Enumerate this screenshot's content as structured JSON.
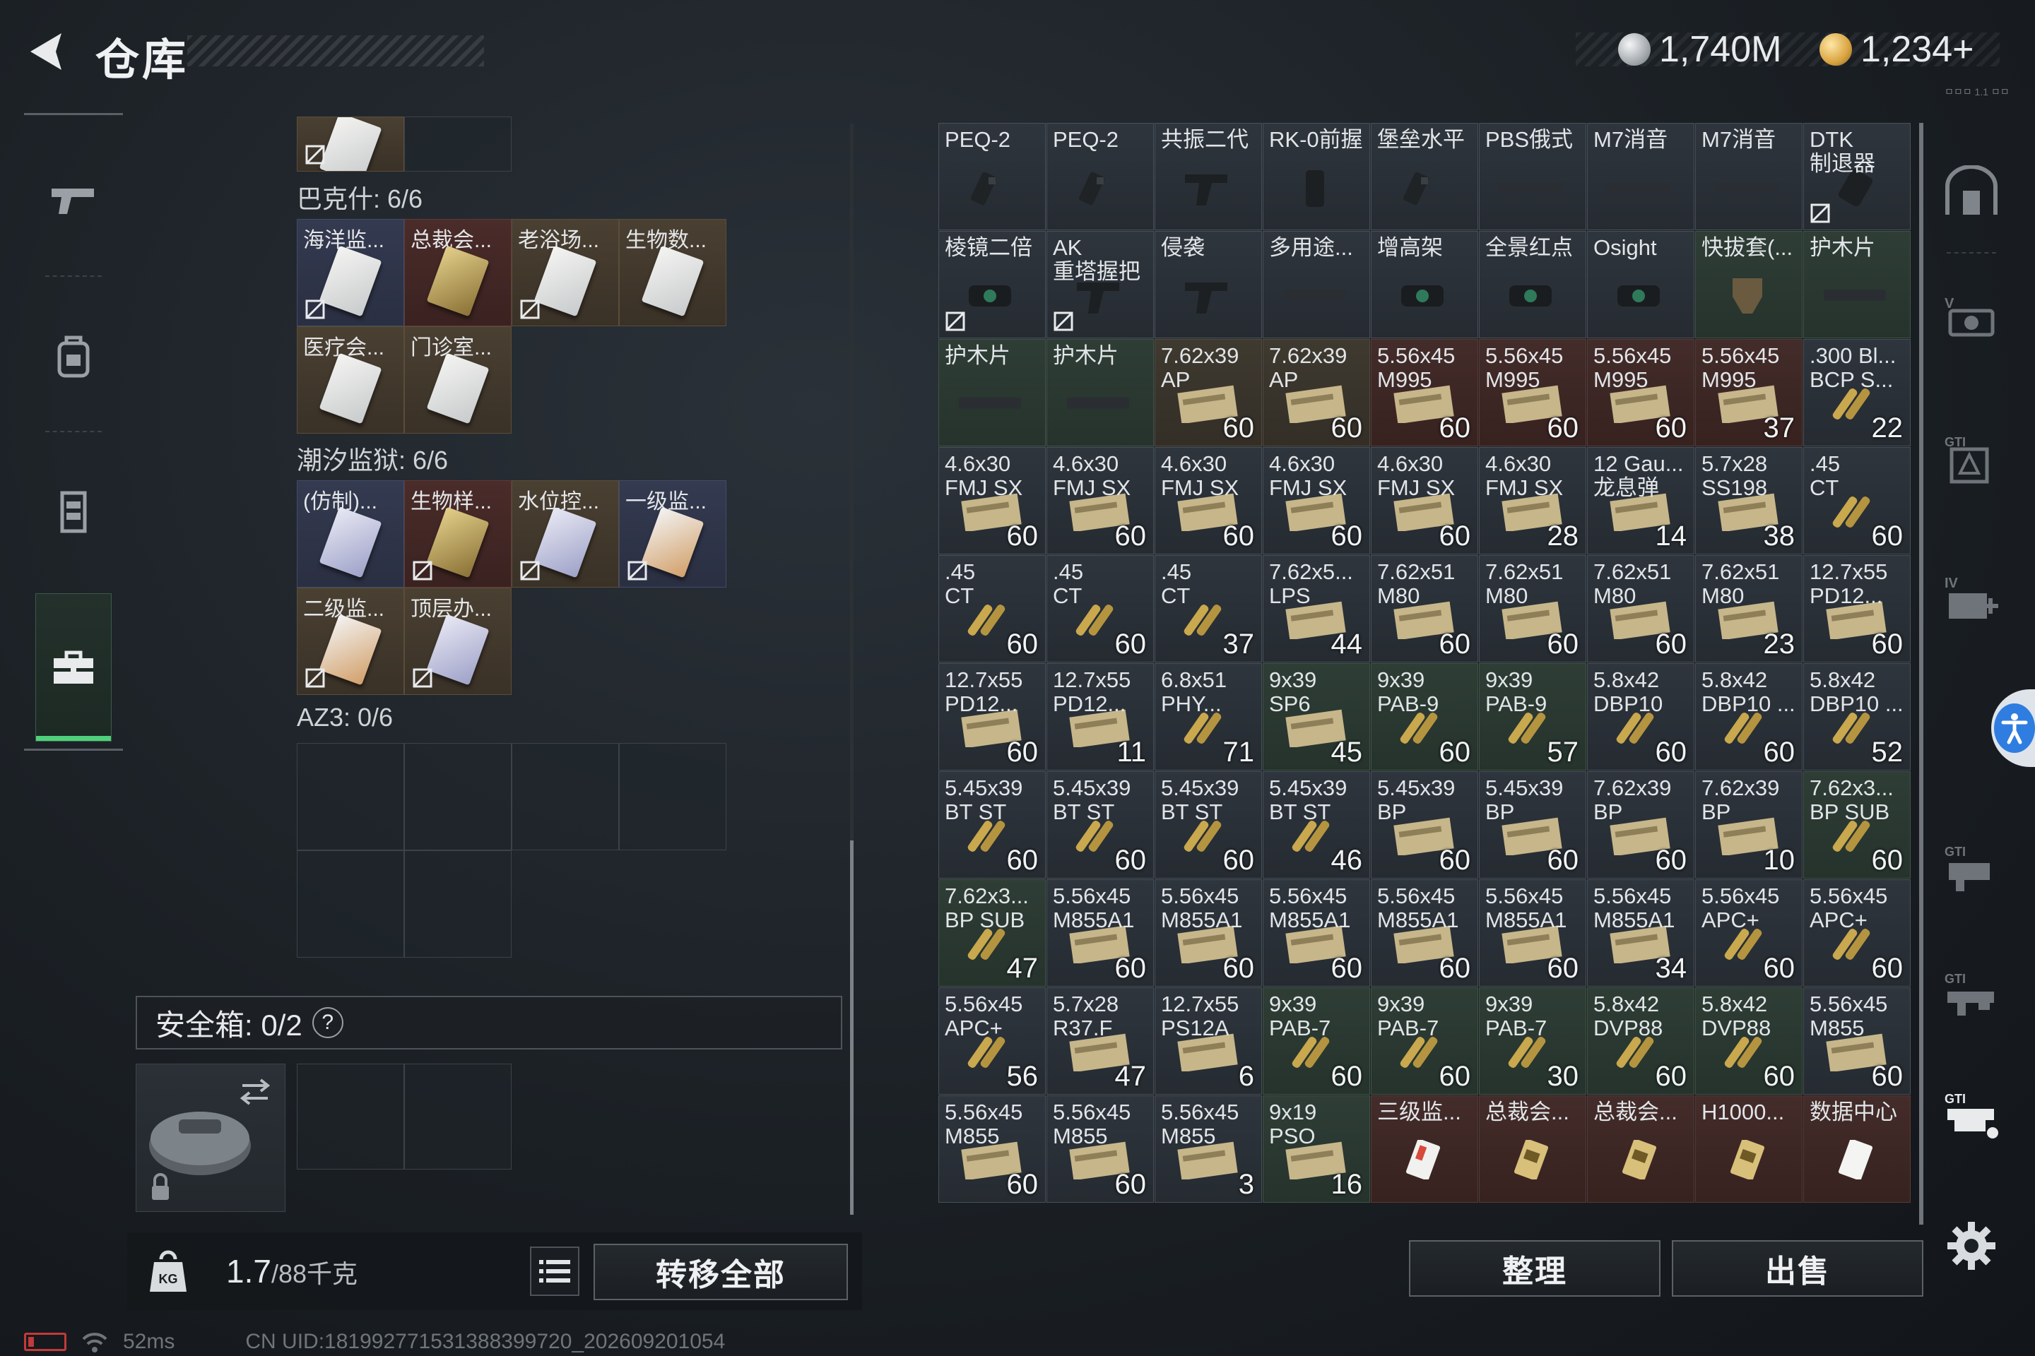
{
  "header": {
    "title": "仓库",
    "currency_silver": "1,740M",
    "currency_gold": "1,234+",
    "build_tag": "ㅁㅁㅁ 1.1 ㅁㅁ",
    "colors": {
      "silver": "#c9ccd0",
      "gold": "#d9a441",
      "accent_green": "#4fd07a"
    }
  },
  "left_nav": {
    "items": [
      {
        "icon": "pistol-icon",
        "active": false
      },
      {
        "icon": "backpack-icon",
        "active": false
      },
      {
        "icon": "vest-icon",
        "active": false
      },
      {
        "icon": "toolbox-icon",
        "active": true
      }
    ]
  },
  "storage": {
    "regions": [
      {
        "label": "巴克什: 6/6"
      },
      {
        "label": "潮汐监狱: 6/6"
      },
      {
        "label": "AZ3: 0/6"
      }
    ],
    "top_partial": [
      {
        "name": "",
        "style": "beige",
        "card": "white",
        "nolink": true
      },
      {
        "name": "",
        "style": "empty",
        "card": "",
        "nolink": false
      }
    ],
    "bakshi": [
      {
        "name": "海洋监...",
        "style": "blue",
        "card": "white",
        "nolink": true
      },
      {
        "name": "总裁会...",
        "style": "red",
        "card": "gold",
        "nolink": false
      },
      {
        "name": "老浴场...",
        "style": "beige",
        "card": "white",
        "nolink": true
      },
      {
        "name": "生物数...",
        "style": "beige",
        "card": "white",
        "nolink": false
      },
      {
        "name": "医疗会...",
        "style": "beige",
        "card": "white",
        "nolink": false
      },
      {
        "name": "门诊室...",
        "style": "beige",
        "card": "white",
        "nolink": false
      }
    ],
    "tidal": [
      {
        "name": "(仿制)...",
        "style": "blue",
        "card": "purple",
        "nolink": false
      },
      {
        "name": "生物样...",
        "style": "red",
        "card": "gold",
        "nolink": true
      },
      {
        "name": "水位控...",
        "style": "beige",
        "card": "purple",
        "nolink": true
      },
      {
        "name": "一级监...",
        "style": "blue",
        "card": "orange",
        "nolink": true
      },
      {
        "name": "二级监...",
        "style": "beige",
        "card": "orange",
        "nolink": true
      },
      {
        "name": "顶层办...",
        "style": "beige",
        "card": "purple",
        "nolink": true
      }
    ],
    "safebox_label": "安全箱: 0/2",
    "safebox_help": "?",
    "weight_value": "1.7",
    "weight_capacity": "/88千克",
    "transfer_all_label": "转移全部"
  },
  "status": {
    "latency": "52ms",
    "uid": "CN UID:181992771531388399720_202609201054"
  },
  "inventory": [
    {
      "l1": "PEQ-2",
      "l2": "",
      "qty": "",
      "style": "dark",
      "art": "laser",
      "nolink": false
    },
    {
      "l1": "PEQ-2",
      "l2": "",
      "qty": "",
      "style": "dark",
      "art": "laser",
      "nolink": false
    },
    {
      "l1": "共振二代",
      "l2": "",
      "qty": "",
      "style": "dark",
      "art": "grip",
      "nolink": false
    },
    {
      "l1": "RK-0前握",
      "l2": "",
      "qty": "",
      "style": "dark",
      "art": "vgrip",
      "nolink": false
    },
    {
      "l1": "堡垒水平",
      "l2": "",
      "qty": "",
      "style": "dark",
      "art": "laser",
      "nolink": false
    },
    {
      "l1": "PBS俄式",
      "l2": "",
      "qty": "",
      "style": "dark",
      "art": "barrel",
      "nolink": false
    },
    {
      "l1": "M7消音",
      "l2": "",
      "qty": "",
      "style": "dark",
      "art": "barrel",
      "nolink": false
    },
    {
      "l1": "M7消音",
      "l2": "",
      "qty": "",
      "style": "dark",
      "art": "barrel",
      "nolink": false
    },
    {
      "l1": "DTK",
      "l2": "制退器",
      "qty": "",
      "style": "dark",
      "art": "muzzle",
      "nolink": true
    },
    {
      "l1": "棱镜二倍",
      "l2": "",
      "qty": "",
      "style": "dark",
      "art": "scope",
      "nolink": true
    },
    {
      "l1": "AK",
      "l2": "重塔握把",
      "qty": "",
      "style": "dark",
      "art": "grip",
      "nolink": true
    },
    {
      "l1": "侵袭",
      "l2": "",
      "qty": "",
      "style": "dark",
      "art": "grip",
      "nolink": false
    },
    {
      "l1": "多用途...",
      "l2": "",
      "qty": "",
      "style": "dark",
      "art": "rail",
      "nolink": false
    },
    {
      "l1": "增高架",
      "l2": "",
      "qty": "",
      "style": "dark",
      "art": "scope",
      "nolink": false
    },
    {
      "l1": "全景红点",
      "l2": "",
      "qty": "",
      "style": "dark",
      "art": "scope",
      "nolink": false
    },
    {
      "l1": "Osight",
      "l2": "",
      "qty": "",
      "style": "dark",
      "art": "scope",
      "nolink": false
    },
    {
      "l1": "快拔套(...",
      "l2": "",
      "qty": "",
      "style": "green",
      "art": "holster",
      "nolink": false
    },
    {
      "l1": "护木片",
      "l2": "",
      "qty": "",
      "style": "green",
      "art": "rail",
      "nolink": false
    },
    {
      "l1": "护木片",
      "l2": "",
      "qty": "",
      "style": "green",
      "art": "rail",
      "nolink": false
    },
    {
      "l1": "护木片",
      "l2": "",
      "qty": "",
      "style": "green",
      "art": "rail",
      "nolink": false
    },
    {
      "l1": "7.62x39",
      "l2": "AP",
      "qty": "60",
      "style": "beige",
      "art": "ammobox",
      "nolink": false
    },
    {
      "l1": "7.62x39",
      "l2": "AP",
      "qty": "60",
      "style": "beige",
      "art": "ammobox",
      "nolink": false
    },
    {
      "l1": "5.56x45",
      "l2": "M995",
      "qty": "60",
      "style": "red",
      "art": "ammobox",
      "nolink": false
    },
    {
      "l1": "5.56x45",
      "l2": "M995",
      "qty": "60",
      "style": "red",
      "art": "ammobox",
      "nolink": false
    },
    {
      "l1": "5.56x45",
      "l2": "M995",
      "qty": "60",
      "style": "red",
      "art": "ammobox",
      "nolink": false
    },
    {
      "l1": "5.56x45",
      "l2": "M995",
      "qty": "37",
      "style": "red",
      "art": "ammobox",
      "nolink": false
    },
    {
      "l1": ".300 Bl...",
      "l2": "BCP S...",
      "qty": "22",
      "style": "dark",
      "art": "rounds",
      "nolink": false
    },
    {
      "l1": "4.6x30",
      "l2": "FMJ SX",
      "qty": "60",
      "style": "dark",
      "art": "ammobox",
      "nolink": false
    },
    {
      "l1": "4.6x30",
      "l2": "FMJ SX",
      "qty": "60",
      "style": "dark",
      "art": "ammobox",
      "nolink": false
    },
    {
      "l1": "4.6x30",
      "l2": "FMJ SX",
      "qty": "60",
      "style": "dark",
      "art": "ammobox",
      "nolink": false
    },
    {
      "l1": "4.6x30",
      "l2": "FMJ SX",
      "qty": "60",
      "style": "dark",
      "art": "ammobox",
      "nolink": false
    },
    {
      "l1": "4.6x30",
      "l2": "FMJ SX",
      "qty": "60",
      "style": "dark",
      "art": "ammobox",
      "nolink": false
    },
    {
      "l1": "4.6x30",
      "l2": "FMJ SX",
      "qty": "28",
      "style": "dark",
      "art": "ammobox",
      "nolink": false
    },
    {
      "l1": "12 Gau...",
      "l2": "龙息弹",
      "qty": "14",
      "style": "dark",
      "art": "ammobox",
      "nolink": false
    },
    {
      "l1": "5.7x28",
      "l2": "SS198",
      "qty": "38",
      "style": "dark",
      "art": "ammobox",
      "nolink": false
    },
    {
      "l1": ".45",
      "l2": "CT",
      "qty": "60",
      "style": "dark",
      "art": "rounds",
      "nolink": false
    },
    {
      "l1": ".45",
      "l2": "CT",
      "qty": "60",
      "style": "dark",
      "art": "rounds",
      "nolink": false
    },
    {
      "l1": ".45",
      "l2": "CT",
      "qty": "60",
      "style": "dark",
      "art": "rounds",
      "nolink": false
    },
    {
      "l1": ".45",
      "l2": "CT",
      "qty": "37",
      "style": "dark",
      "art": "rounds",
      "nolink": false
    },
    {
      "l1": "7.62x5...",
      "l2": "LPS",
      "qty": "44",
      "style": "dark",
      "art": "ammobox",
      "nolink": false
    },
    {
      "l1": "7.62x51",
      "l2": "M80",
      "qty": "60",
      "style": "dark",
      "art": "ammobox",
      "nolink": false
    },
    {
      "l1": "7.62x51",
      "l2": "M80",
      "qty": "60",
      "style": "dark",
      "art": "ammobox",
      "nolink": false
    },
    {
      "l1": "7.62x51",
      "l2": "M80",
      "qty": "60",
      "style": "dark",
      "art": "ammobox",
      "nolink": false
    },
    {
      "l1": "7.62x51",
      "l2": "M80",
      "qty": "23",
      "style": "dark",
      "art": "ammobox",
      "nolink": false
    },
    {
      "l1": "12.7x55",
      "l2": "PD12...",
      "qty": "60",
      "style": "dark",
      "art": "ammobox",
      "nolink": false
    },
    {
      "l1": "12.7x55",
      "l2": "PD12...",
      "qty": "60",
      "style": "dark",
      "art": "ammobox",
      "nolink": false
    },
    {
      "l1": "12.7x55",
      "l2": "PD12...",
      "qty": "11",
      "style": "dark",
      "art": "ammobox",
      "nolink": false
    },
    {
      "l1": "6.8x51",
      "l2": "PHY...",
      "qty": "71",
      "style": "dark",
      "art": "rounds",
      "nolink": false
    },
    {
      "l1": "9x39",
      "l2": "SP6",
      "qty": "45",
      "style": "green",
      "art": "ammobox",
      "nolink": false
    },
    {
      "l1": "9x39",
      "l2": "PAB-9",
      "qty": "60",
      "style": "green",
      "art": "rounds",
      "nolink": false
    },
    {
      "l1": "9x39",
      "l2": "PAB-9",
      "qty": "57",
      "style": "green",
      "art": "rounds",
      "nolink": false
    },
    {
      "l1": "5.8x42",
      "l2": "DBP10",
      "qty": "60",
      "style": "dark",
      "art": "rounds",
      "nolink": false
    },
    {
      "l1": "5.8x42",
      "l2": "DBP10 ...",
      "qty": "60",
      "style": "dark",
      "art": "rounds",
      "nolink": false
    },
    {
      "l1": "5.8x42",
      "l2": "DBP10 ...",
      "qty": "52",
      "style": "dark",
      "art": "rounds",
      "nolink": false
    },
    {
      "l1": "5.45x39",
      "l2": "BT ST",
      "qty": "60",
      "style": "dark",
      "art": "rounds",
      "nolink": false
    },
    {
      "l1": "5.45x39",
      "l2": "BT ST",
      "qty": "60",
      "style": "dark",
      "art": "rounds",
      "nolink": false
    },
    {
      "l1": "5.45x39",
      "l2": "BT ST",
      "qty": "60",
      "style": "dark",
      "art": "rounds",
      "nolink": false
    },
    {
      "l1": "5.45x39",
      "l2": "BT ST",
      "qty": "46",
      "style": "dark",
      "art": "rounds",
      "nolink": false
    },
    {
      "l1": "5.45x39",
      "l2": "BP",
      "qty": "60",
      "style": "dark",
      "art": "ammobox",
      "nolink": false
    },
    {
      "l1": "5.45x39",
      "l2": "BP",
      "qty": "60",
      "style": "dark",
      "art": "ammobox",
      "nolink": false
    },
    {
      "l1": "7.62x39",
      "l2": "BP",
      "qty": "60",
      "style": "dark",
      "art": "ammobox",
      "nolink": false
    },
    {
      "l1": "7.62x39",
      "l2": "BP",
      "qty": "10",
      "style": "dark",
      "art": "ammobox",
      "nolink": false
    },
    {
      "l1": "7.62x3...",
      "l2": "BP SUB",
      "qty": "60",
      "style": "green",
      "art": "rounds",
      "nolink": false
    },
    {
      "l1": "7.62x3...",
      "l2": "BP SUB",
      "qty": "47",
      "style": "green",
      "art": "rounds",
      "nolink": false
    },
    {
      "l1": "5.56x45",
      "l2": "M855A1",
      "qty": "60",
      "style": "dark",
      "art": "ammobox",
      "nolink": false
    },
    {
      "l1": "5.56x45",
      "l2": "M855A1",
      "qty": "60",
      "style": "dark",
      "art": "ammobox",
      "nolink": false
    },
    {
      "l1": "5.56x45",
      "l2": "M855A1",
      "qty": "60",
      "style": "dark",
      "art": "ammobox",
      "nolink": false
    },
    {
      "l1": "5.56x45",
      "l2": "M855A1",
      "qty": "60",
      "style": "dark",
      "art": "ammobox",
      "nolink": false
    },
    {
      "l1": "5.56x45",
      "l2": "M855A1",
      "qty": "60",
      "style": "dark",
      "art": "ammobox",
      "nolink": false
    },
    {
      "l1": "5.56x45",
      "l2": "M855A1",
      "qty": "34",
      "style": "dark",
      "art": "ammobox",
      "nolink": false
    },
    {
      "l1": "5.56x45",
      "l2": "APC+",
      "qty": "60",
      "style": "dark",
      "art": "rounds",
      "nolink": false
    },
    {
      "l1": "5.56x45",
      "l2": "APC+",
      "qty": "60",
      "style": "dark",
      "art": "rounds",
      "nolink": false
    },
    {
      "l1": "5.56x45",
      "l2": "APC+",
      "qty": "56",
      "style": "dark",
      "art": "rounds",
      "nolink": false
    },
    {
      "l1": "5.7x28",
      "l2": "R37.F",
      "qty": "47",
      "style": "dark",
      "art": "ammobox",
      "nolink": false
    },
    {
      "l1": "12.7x55",
      "l2": "PS12A",
      "qty": "6",
      "style": "dark",
      "art": "ammobox",
      "nolink": false
    },
    {
      "l1": "9x39",
      "l2": "PAB-7",
      "qty": "60",
      "style": "green",
      "art": "rounds",
      "nolink": false
    },
    {
      "l1": "9x39",
      "l2": "PAB-7",
      "qty": "60",
      "style": "green",
      "art": "rounds",
      "nolink": false
    },
    {
      "l1": "9x39",
      "l2": "PAB-7",
      "qty": "30",
      "style": "green",
      "art": "rounds",
      "nolink": false
    },
    {
      "l1": "5.8x42",
      "l2": "DVP88",
      "qty": "60",
      "style": "green",
      "art": "rounds",
      "nolink": false
    },
    {
      "l1": "5.8x42",
      "l2": "DVP88",
      "qty": "60",
      "style": "green",
      "art": "rounds",
      "nolink": false
    },
    {
      "l1": "5.56x45",
      "l2": "M855",
      "qty": "60",
      "style": "dark",
      "art": "ammobox",
      "nolink": false
    },
    {
      "l1": "5.56x45",
      "l2": "M855",
      "qty": "60",
      "style": "dark",
      "art": "ammobox",
      "nolink": false
    },
    {
      "l1": "5.56x45",
      "l2": "M855",
      "qty": "60",
      "style": "dark",
      "art": "ammobox",
      "nolink": false
    },
    {
      "l1": "5.56x45",
      "l2": "M855",
      "qty": "3",
      "style": "dark",
      "art": "ammobox",
      "nolink": false
    },
    {
      "l1": "9x19",
      "l2": "PSO",
      "qty": "16",
      "style": "green",
      "art": "ammobox",
      "nolink": false
    },
    {
      "l1": "三级监...",
      "l2": "",
      "qty": "",
      "style": "red",
      "art": "card-red",
      "nolink": false
    },
    {
      "l1": "总裁会...",
      "l2": "",
      "qty": "",
      "style": "red",
      "art": "card-gold",
      "nolink": false
    },
    {
      "l1": "总裁会...",
      "l2": "",
      "qty": "",
      "style": "red",
      "art": "card-gold",
      "nolink": false
    },
    {
      "l1": "H1000...",
      "l2": "",
      "qty": "",
      "style": "red",
      "art": "card-gold",
      "nolink": false
    },
    {
      "l1": "数据中心",
      "l2": "",
      "qty": "",
      "style": "red",
      "art": "card-white",
      "nolink": false
    }
  ],
  "actions": {
    "sort_label": "整理",
    "sell_label": "出售"
  },
  "right_tabs": [
    {
      "icon": "safe-tab-icon"
    },
    {
      "icon": "scope-tab-icon"
    },
    {
      "icon": "key-tab-icon"
    },
    {
      "icon": "medical-tab-icon"
    },
    {
      "icon": "attachment-tab-icon"
    },
    {
      "icon": "gun-tab-icon"
    },
    {
      "icon": "storage-tab-icon"
    }
  ]
}
